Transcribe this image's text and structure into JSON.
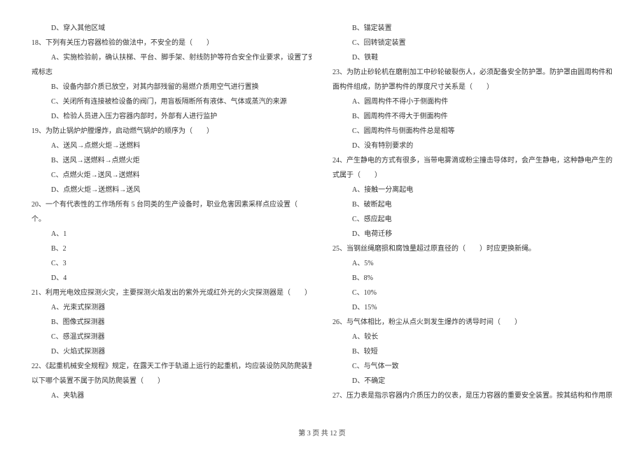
{
  "left": {
    "q17_d": "D、穿入其他区域",
    "q18": "18、下列有关压力容器检验的做法中，不安全的是（　　）",
    "q18_a": "A、实施检验前，确认扶梯、平台、脚手架、射线防护等符合安全作业要求，设置了安全警",
    "q18_a2": "戒标志",
    "q18_b": "B、设备内部介质已放空，对其内部残留的易燃介质用空气进行置换",
    "q18_c": "C、关闭所有连接被检设备的阀门，用盲板隔断所有液体、气体或蒸汽的来源",
    "q18_d": "D、检验人员进入压力容器内部时，外部有人进行监护",
    "q19": "19、为防止锅炉炉膛爆炸，启动燃气锅炉的顺序为（　　）",
    "q19_a": "A、送风→点燃火炬→送燃料",
    "q19_b": "B、送风→送燃料→点燃火炬",
    "q19_c": "C、点燃火炬→送风→送燃料",
    "q19_d": "D、点燃火炬→送燃料→送风",
    "q20": "20、一个有代表性的工作场所有 5 台同类的生产设备时，职业危害因素采样点应设置（　　）",
    "q20_2": "个。",
    "q20_a": "A、1",
    "q20_b": "B、2",
    "q20_c": "C、3",
    "q20_d": "D、4",
    "q21": "21、利用光电效应探测火灾，主要探测火焰发出的紫外光或红外光的火灾探测器是（　　）",
    "q21_a": "A、光束式探测器",
    "q21_b": "B、图像式探测器",
    "q21_c": "C、感温式探测器",
    "q21_d": "D、火焰式探测器",
    "q22": "22、《起重机械安全规程》规定，在露天工作于轨道上运行的起重机，均应装设防风防爬装置。",
    "q22_2": "以下哪个装置不属于防风防爬装置（　　）",
    "q22_a": "A、夹轨器"
  },
  "right": {
    "q22_b": "B、锚定装置",
    "q22_c": "C、回转锁定装置",
    "q22_d": "D、铁鞋",
    "q23": "23、为防止砂轮机在磨削加工中砂轮破裂伤人，必须配备安全防护罩。防护罩由圆周构件和侧",
    "q23_2": "面构件组成，防护罩构件的厚度尺寸关系是（　　）",
    "q23_a": "A、圆周构件不得小于侧面构件",
    "q23_b": "B、圆周构件不得大于侧面构件",
    "q23_c": "C、圆周构件与侧面构件总是相等",
    "q23_d": "D、没有特别要求的",
    "q24": "24、产生静电的方式有很多，当带电雾滴或粉尘撞击导体时，会产生静电，这种静电产生的方",
    "q24_2": "式属于（　　）",
    "q24_a": "A、接触一分离起电",
    "q24_b": "B、破断起电",
    "q24_c": "C、感应起电",
    "q24_d": "D、电荷迁移",
    "q25": "25、当钢丝绳磨损和腐蚀量超过原直径的（　　）时应更换新绳。",
    "q25_a": "A、5%",
    "q25_b": "B、8%",
    "q25_c": "C、10%",
    "q25_d": "D、15%",
    "q26": "26、与气体相比，粉尘从点火到发生爆炸的诱导时间（　　）",
    "q26_a": "A、较长",
    "q26_b": "B、较短",
    "q26_c": "C、与气体一致",
    "q26_d": "D、不确定",
    "q27": "27、压力表是指示容器内介质压力的仪表，是压力容器的重要安全装置。按其结构和作用原理，"
  },
  "footer": "第 3 页 共 12 页"
}
